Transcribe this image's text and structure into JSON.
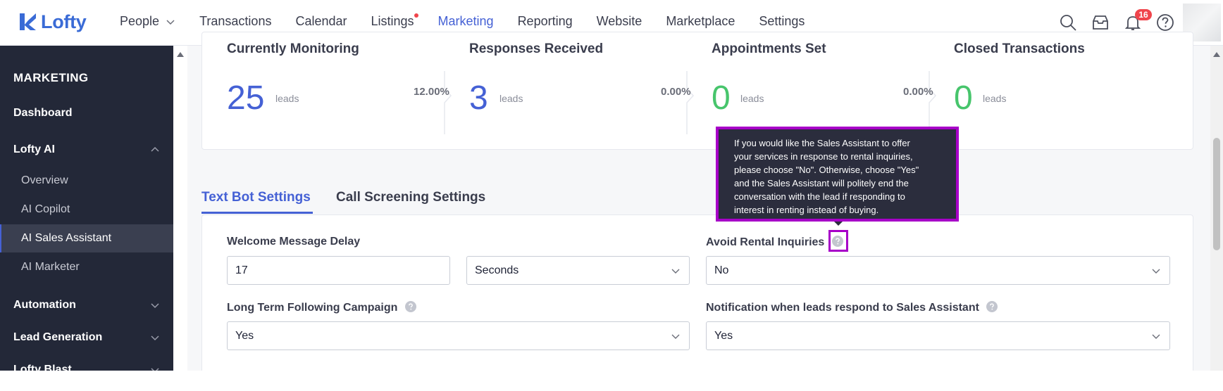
{
  "app": {
    "logo_text": "Lofty"
  },
  "nav": {
    "items": [
      {
        "label": "People",
        "has_caret": true
      },
      {
        "label": "Transactions"
      },
      {
        "label": "Calendar"
      },
      {
        "label": "Listings",
        "has_dot": true
      },
      {
        "label": "Marketing",
        "active": true
      },
      {
        "label": "Reporting"
      },
      {
        "label": "Website"
      },
      {
        "label": "Marketplace"
      },
      {
        "label": "Settings"
      }
    ],
    "notification_count": "16",
    "accent_color": "#4561d5"
  },
  "sidebar": {
    "title": "MARKETING",
    "items": [
      {
        "label": "Dashboard"
      },
      {
        "label": "Lofty AI"
      },
      {
        "label": "Overview"
      },
      {
        "label": "AI Copilot"
      },
      {
        "label": "AI Sales Assistant"
      },
      {
        "label": "AI Marketer"
      },
      {
        "label": "Automation"
      },
      {
        "label": "Lead Generation"
      },
      {
        "label": "Lofty Blast"
      }
    ]
  },
  "stats": [
    {
      "label": "Currently Monitoring",
      "value": "25",
      "unit": "leads"
    },
    {
      "label": "Responses Received",
      "value": "3",
      "unit": "leads",
      "pct": "12.00%"
    },
    {
      "label": "Appointments Set",
      "value": "0",
      "unit": "leads",
      "pct": "0.00%"
    },
    {
      "label": "Closed Transactions",
      "value": "0",
      "unit": "leads",
      "pct": "0.00%"
    }
  ],
  "tabs": {
    "text_bot": "Text Bot Settings",
    "call_screening": "Call Screening Settings"
  },
  "form": {
    "welcome_delay_label": "Welcome Message Delay",
    "welcome_delay_value": "17",
    "welcome_delay_unit": "Seconds",
    "avoid_rental_label": "Avoid Rental Inquiries",
    "avoid_rental_value": "No",
    "long_term_label": "Long Term Following Campaign",
    "long_term_value": "Yes",
    "notification_label": "Notification when leads respond to Sales Assistant",
    "notification_value": "Yes"
  },
  "tooltip": {
    "lines": [
      "If you would like the Sales Assistant to offer",
      "your services in response to rental inquiries,",
      "please choose \"No\". Otherwise, choose \"Yes\"",
      "and the Sales Assistant will politely end the",
      "conversation with the lead if responding to",
      "interest in renting instead of buying."
    ]
  }
}
